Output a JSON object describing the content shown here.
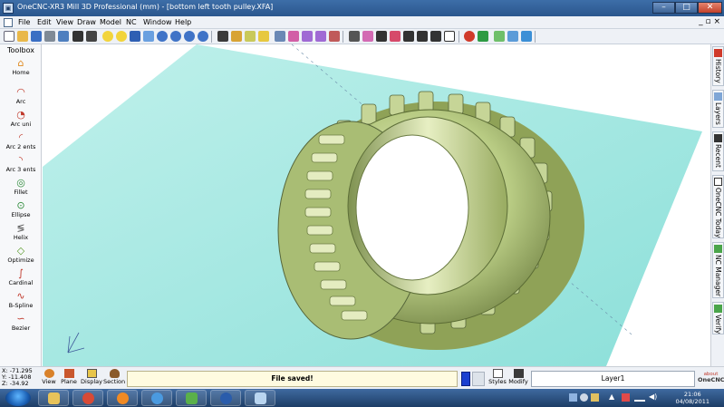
{
  "window": {
    "title": "OneCNC-XR3 Mill 3D Professional (mm) - [bottom left tooth pulley.XFA]",
    "minimize": "–",
    "maximize": "□",
    "close": "✕"
  },
  "menu": {
    "items": [
      "File",
      "Edit",
      "View",
      "Draw",
      "Model",
      "NC",
      "Window",
      "Help"
    ],
    "mdi_controls": "_ ▫ ×"
  },
  "toolbox": {
    "title": "Toolbox",
    "items": [
      {
        "label": "Home",
        "icon": "home-icon"
      },
      {
        "label": "Arc",
        "icon": "arc-icon"
      },
      {
        "label": "Arc uni",
        "icon": "arc-uni-icon"
      },
      {
        "label": "Arc 2 ents",
        "icon": "arc-2-ents-icon"
      },
      {
        "label": "Arc 3 ents",
        "icon": "arc-3-ents-icon"
      },
      {
        "label": "Fillet",
        "icon": "fillet-icon"
      },
      {
        "label": "Ellipse",
        "icon": "ellipse-icon"
      },
      {
        "label": "Helix",
        "icon": "helix-icon"
      },
      {
        "label": "Optimize",
        "icon": "optimize-icon"
      },
      {
        "label": "Cardinal",
        "icon": "cardinal-icon"
      },
      {
        "label": "B-Spline",
        "icon": "b-spline-icon"
      },
      {
        "label": "Bezier",
        "icon": "bezier-icon"
      }
    ]
  },
  "right_tabs": [
    {
      "label": "History",
      "icon": "history-icon"
    },
    {
      "label": "Layers",
      "icon": "layers-icon"
    },
    {
      "label": "Recent",
      "icon": "recent-icon"
    },
    {
      "label": "OneCNC Today",
      "icon": "onecnc-today-icon"
    },
    {
      "label": "NC Manager",
      "icon": "nc-manager-icon"
    },
    {
      "label": "Verify",
      "icon": "verify-icon"
    }
  ],
  "status": {
    "coord_x": "X: -71.295",
    "coord_y": "Y: -11.408",
    "coord_z": "Z: -34.92",
    "view_label": "View",
    "plane_label": "Plane",
    "display_label": "Display",
    "section_label": "Section",
    "message": "File saved!",
    "styles_label": "Styles",
    "modify_label": "Modify",
    "layer": "Layer1",
    "about_small": "about",
    "about_brand": "OneCNC"
  },
  "taskbar": {
    "time": "21:06",
    "date": "04/08/2011"
  },
  "colors": {
    "viewport_plane": "#8fe3dd",
    "part": "#b9cc86",
    "part_dark": "#5a6b34",
    "current_color": "#1a3fd0"
  }
}
